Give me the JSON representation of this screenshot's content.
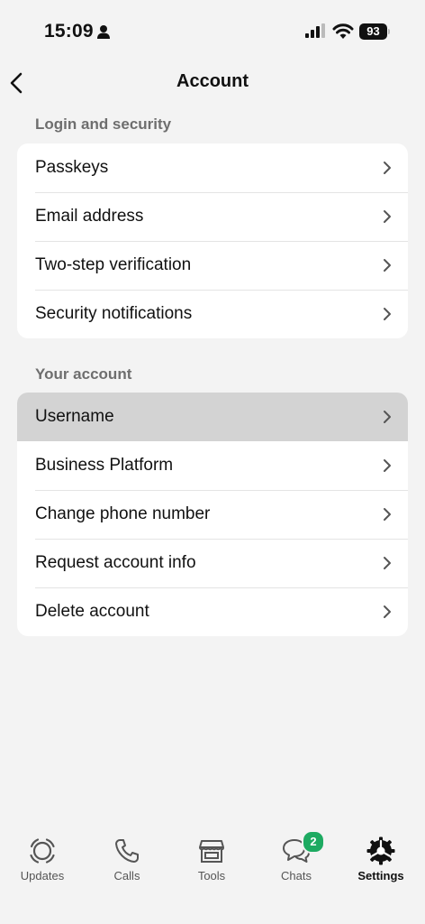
{
  "status_bar": {
    "time": "15:09",
    "battery_level": "93",
    "icons": [
      "person-icon",
      "signal-icon",
      "wifi-icon",
      "battery-icon"
    ]
  },
  "header": {
    "title": "Account",
    "back_icon": "chevron-left-icon"
  },
  "sections": [
    {
      "label": "Login and security",
      "items": [
        {
          "label": "Passkeys"
        },
        {
          "label": "Email address"
        },
        {
          "label": "Two-step verification"
        },
        {
          "label": "Security notifications"
        }
      ]
    },
    {
      "label": "Your account",
      "items": [
        {
          "label": "Username",
          "highlighted": true
        },
        {
          "label": "Business Platform"
        },
        {
          "label": "Change phone number"
        },
        {
          "label": "Request account info"
        },
        {
          "label": "Delete account"
        }
      ]
    }
  ],
  "tab_bar": {
    "tabs": [
      {
        "label": "Updates",
        "icon": "updates-icon"
      },
      {
        "label": "Calls",
        "icon": "phone-icon"
      },
      {
        "label": "Tools",
        "icon": "storefront-icon"
      },
      {
        "label": "Chats",
        "icon": "chat-bubbles-icon",
        "badge": "2"
      },
      {
        "label": "Settings",
        "icon": "settings-gear-icon",
        "active": true
      }
    ]
  },
  "colors": {
    "background": "#f3f3f3",
    "card": "#ffffff",
    "highlight": "#d3d3d3",
    "badge": "#1daa61",
    "section_label": "#6e6e6e"
  }
}
